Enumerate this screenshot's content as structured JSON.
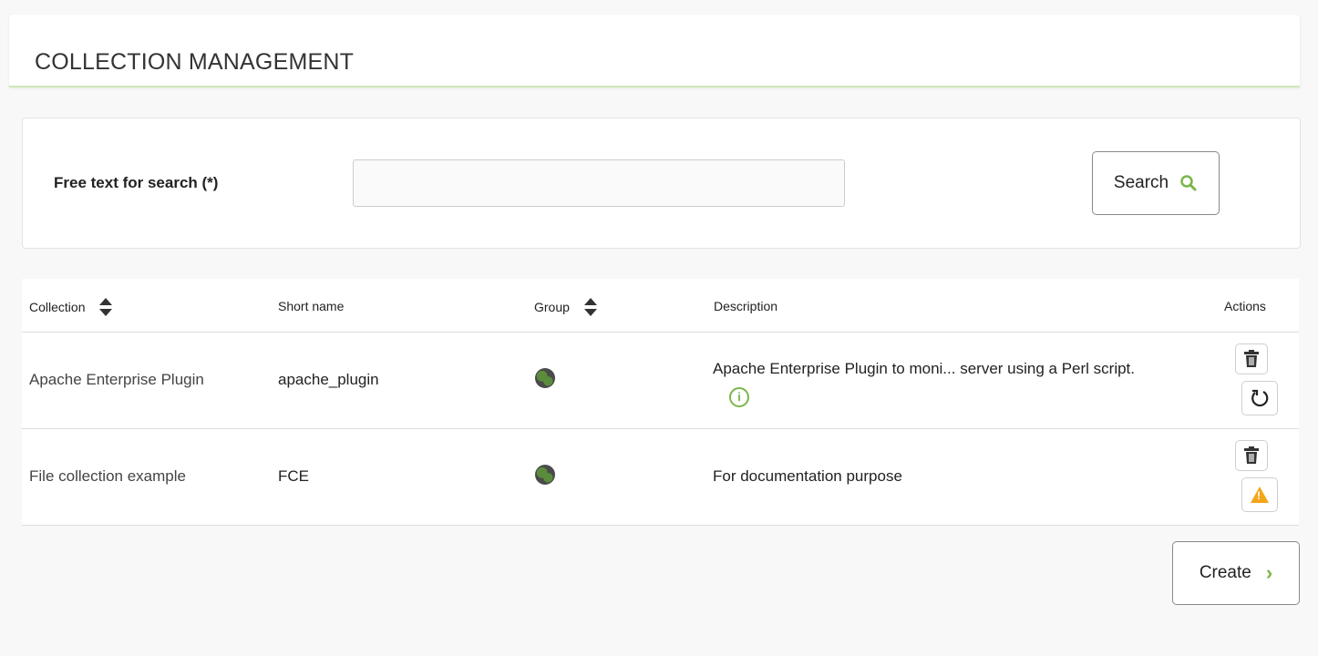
{
  "header": {
    "title": "COLLECTION MANAGEMENT"
  },
  "search": {
    "label": "Free text for search (*)",
    "value": "",
    "placeholder": "",
    "button_label": "Search"
  },
  "table": {
    "columns": {
      "collection": "Collection",
      "short_name": "Short name",
      "group": "Group",
      "description": "Description",
      "actions": "Actions"
    },
    "rows": [
      {
        "collection": "Apache Enterprise Plugin",
        "short_name": "apache_plugin",
        "group_icon": "globe-icon",
        "description": "Apache Enterprise Plugin to moni... server using a Perl script.",
        "has_info": true,
        "actions": [
          "trash-icon",
          "refresh-icon"
        ]
      },
      {
        "collection": "File collection example",
        "short_name": "FCE",
        "group_icon": "globe-icon",
        "description": "For documentation purpose",
        "has_info": false,
        "actions": [
          "trash-icon",
          "warning-icon"
        ]
      }
    ]
  },
  "footer": {
    "create_label": "Create"
  },
  "colors": {
    "accent_green": "#7ab648",
    "warning_orange": "#f4a51c",
    "header_underline": "#cfe6b8"
  }
}
